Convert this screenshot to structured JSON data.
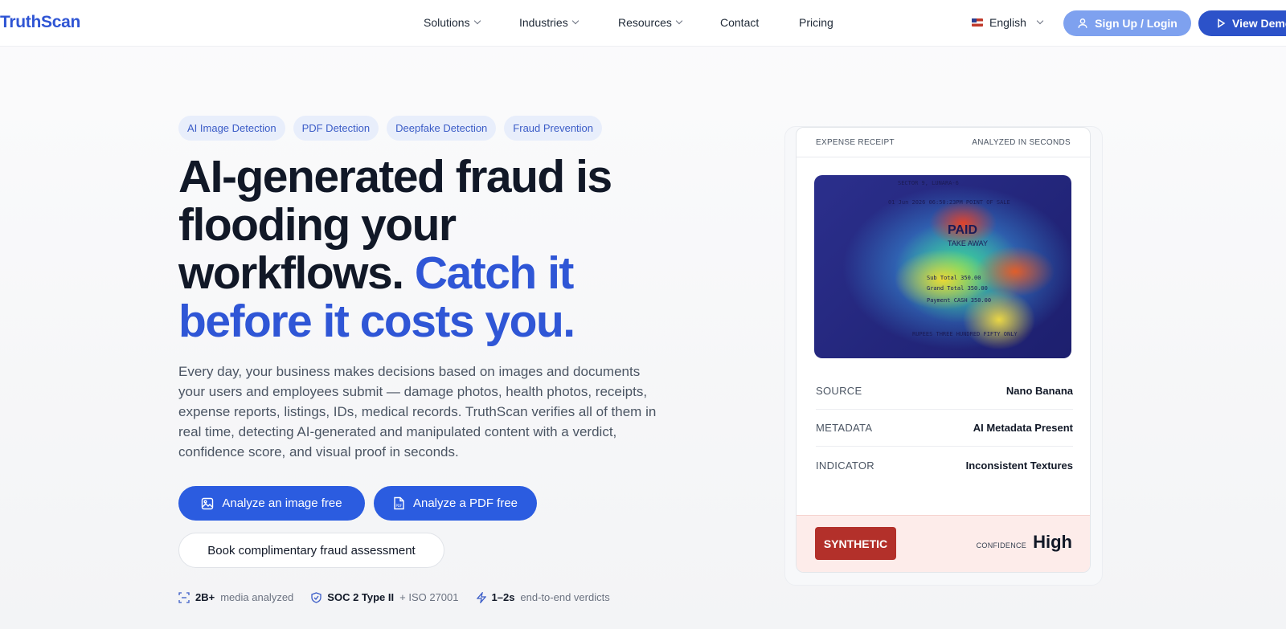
{
  "nav": {
    "logo": "TruthScan",
    "menu": [
      {
        "label": "Solutions"
      },
      {
        "label": "Industries"
      },
      {
        "label": "Resources"
      },
      {
        "label": "Contact"
      },
      {
        "label": "Pricing"
      }
    ],
    "language": "English",
    "signup_label": "Sign Up / Login",
    "demo_label": "View Demo"
  },
  "hero": {
    "chips": [
      "AI Image Detection",
      "PDF Detection",
      "Deepfake Detection",
      "Fraud Prevention"
    ],
    "headline_dark": "AI-generated fraud is flooding your workflows.",
    "headline_blue": "Catch it before it costs you.",
    "lede": "Every day, your business makes decisions based on images and documents your users and employees submit — damage photos, health photos, receipts, expense reports, listings, IDs, medical records. TruthScan verifies all of them in real time, detecting AI-generated and manipulated content with a verdict, confidence score, and visual proof in seconds.",
    "cta_image": "Analyze an image free",
    "cta_pdf": "Analyze a PDF free",
    "cta_book": "Book complimentary fraud assessment"
  },
  "stats": [
    {
      "strong": "2B+",
      "rest": "media analyzed"
    },
    {
      "strong": "SOC 2 Type II",
      "rest": "+ ISO 27001"
    },
    {
      "strong": "1–2s",
      "rest": "end-to-end verdicts"
    }
  ],
  "card": {
    "header_left": "EXPENSE RECEIPT",
    "header_right": "ANALYZED IN SECONDS",
    "receipt": {
      "paid": "PAID",
      "take_away": "TAKE AWAY",
      "line1": "SECTOR 9, LUNARA-6",
      "line2": "01 Jun 2026   06:50:23PM  POINT OF SALE",
      "line3": "Sub Total      350.00",
      "line4": "Grand Total    350.00",
      "line5": "Payment  CASH  350.00",
      "line6": "RUPEES THREE HUNDRED FIFTY ONLY"
    },
    "rows": [
      {
        "key": "SOURCE",
        "value": "Nano Banana"
      },
      {
        "key": "METADATA",
        "value": "AI Metadata Present"
      },
      {
        "key": "INDICATOR",
        "value": "Inconsistent Textures"
      }
    ],
    "verdict": "SYNTHETIC",
    "confidence_label": "CONFIDENCE",
    "confidence_value": "High"
  }
}
